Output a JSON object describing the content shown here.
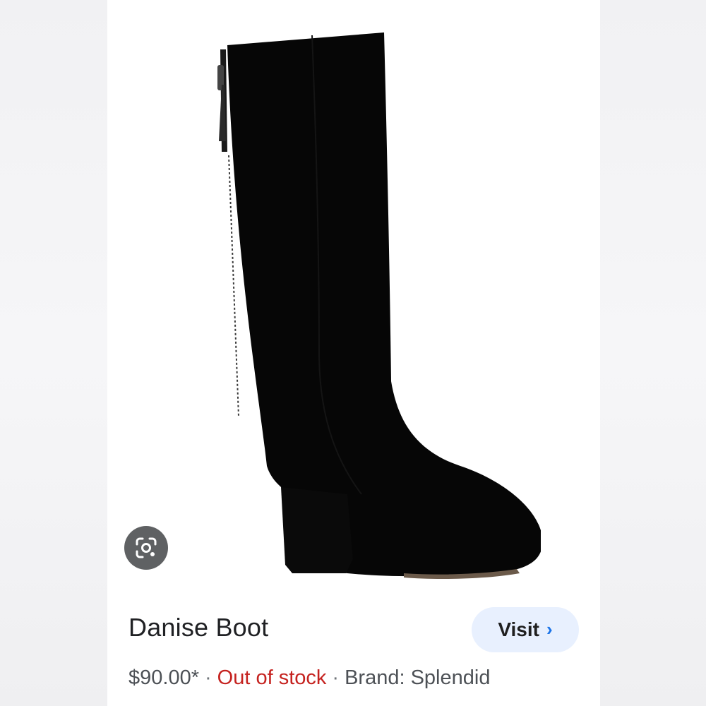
{
  "product": {
    "title": "Danise Boot",
    "price": "$90.00*",
    "separator": "·",
    "stock_status": "Out of stock",
    "brand": "Brand: Splendid",
    "visit_label": "Visit",
    "visit_chevron": "›",
    "image_alt": "Black suede knee-high boot with block heel"
  },
  "icons": {
    "lens": "google-lens-icon",
    "chevron": "chevron-right-icon"
  },
  "colors": {
    "stock_status": "#c5221f",
    "visit_button_bg": "#e8f0fe",
    "visit_chevron": "#1a73e8",
    "lens_button_bg": "#5f6163"
  }
}
